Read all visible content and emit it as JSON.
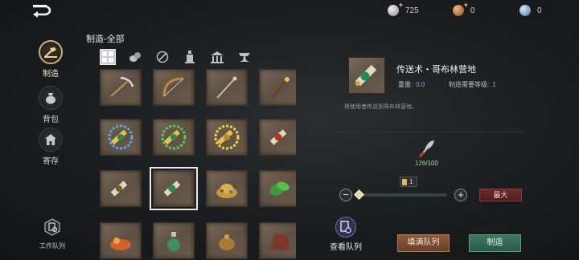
{
  "currencies": [
    {
      "icon": "silver-coin-icon",
      "value": "725",
      "has_plus": true
    },
    {
      "icon": "bronze-coin-icon",
      "value": "0",
      "has_plus": true
    },
    {
      "icon": "blue-gem-icon",
      "value": "0",
      "has_plus": false
    }
  ],
  "nav": {
    "items": [
      {
        "label": "制造",
        "icon": "craft-icon",
        "active": true
      },
      {
        "label": "背包",
        "icon": "bag-icon",
        "active": false
      },
      {
        "label": "寄存",
        "icon": "storage-icon",
        "active": false
      }
    ],
    "worklist_label": "工作队列"
  },
  "category": {
    "title": "制造-全部",
    "tabs": [
      {
        "icon": "all-grid-icon",
        "active": true
      },
      {
        "icon": "materials-icon",
        "active": false
      },
      {
        "icon": "scroll-icon",
        "active": false
      },
      {
        "icon": "potion-icon",
        "active": false
      },
      {
        "icon": "building-icon",
        "active": false
      },
      {
        "icon": "anvil-icon",
        "active": false
      }
    ]
  },
  "grid_items": [
    {
      "icon": "pickaxe-icon"
    },
    {
      "icon": "bow-icon"
    },
    {
      "icon": "staff-icon"
    },
    {
      "icon": "wand-icon"
    },
    {
      "icon": "teleport-scroll-blue-icon"
    },
    {
      "icon": "teleport-scroll-green-icon"
    },
    {
      "icon": "teleport-scroll-gold-icon"
    },
    {
      "icon": "red-scroll-icon"
    },
    {
      "icon": "scroll-icon"
    },
    {
      "icon": "teleport-scroll-icon",
      "selected": true
    },
    {
      "icon": "gold-pile-icon"
    },
    {
      "icon": "herb-icon"
    },
    {
      "icon": "fire-ore-icon"
    },
    {
      "icon": "potion-bottle-icon"
    },
    {
      "icon": "coin-pouch-icon"
    },
    {
      "icon": "leather-icon"
    }
  ],
  "detail": {
    "icon": "teleport-scroll-icon",
    "name": "传送术・哥布林营地",
    "weight_label": "重量:",
    "weight_value": "0.0",
    "level_label": "制造需要等级:",
    "level_value": "1",
    "description": "将使用者传送到哥布林营地。"
  },
  "material": {
    "icon": "feather-material-icon",
    "have": "126",
    "need": "/100"
  },
  "quantity": {
    "value": "1",
    "max_label": "最大",
    "slider_fraction": 0
  },
  "actions": {
    "queue_label": "查看队列",
    "fill_label": "填满队列",
    "craft_label": "制造"
  }
}
